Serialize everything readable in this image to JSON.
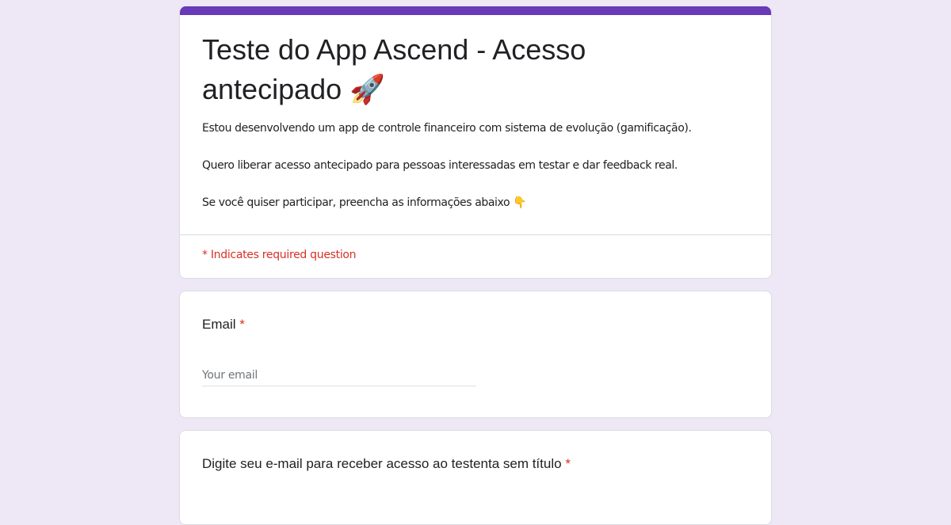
{
  "form": {
    "title_line1": "Teste do App Ascend - Acesso",
    "title_line2": "antecipado",
    "title_emoji": "🚀",
    "description": [
      "Estou desenvolvendo um app de controle financeiro com sistema de evolução (gamificação).",
      "Quero liberar acesso antecipado para pessoas interessadas em testar e dar feedback real.",
      "Se você quiser participar, preencha as informações abaixo 👇"
    ],
    "required_note": "* Indicates required question",
    "accent_color": "#673ab7",
    "background_color": "#ede7f6"
  },
  "questions": [
    {
      "label": "Email",
      "required_marker": "*",
      "placeholder": "Your email"
    },
    {
      "label": "Digite seu e-mail para receber acesso ao testenta sem título",
      "required_marker": "*"
    }
  ]
}
